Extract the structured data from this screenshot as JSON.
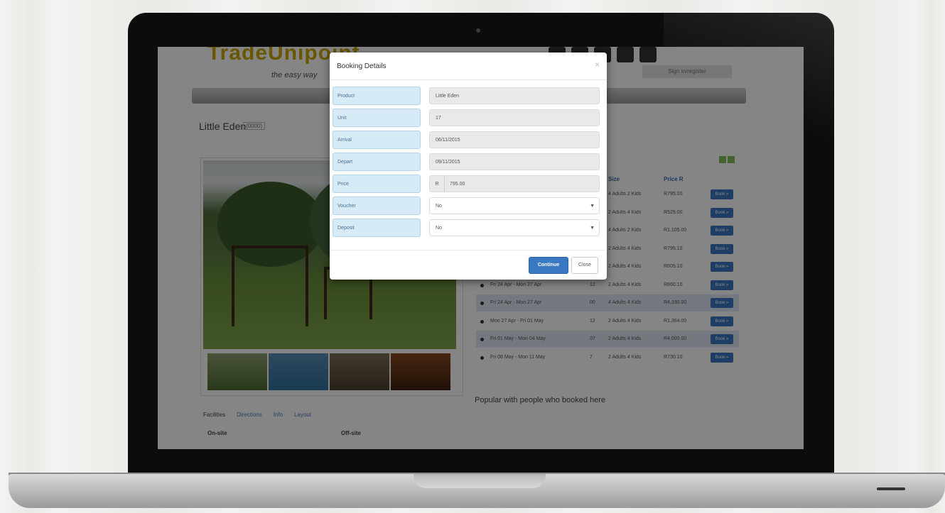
{
  "site": {
    "logo_text": "TradeUnipoint",
    "tagline": "the easy way",
    "sign_in_label": "Sign in/register"
  },
  "page": {
    "title": "Little Eden",
    "title_badge": "(0000)"
  },
  "tabs": [
    {
      "label": "Facilities"
    },
    {
      "label": "Directions"
    },
    {
      "label": "Info"
    },
    {
      "label": "Layout"
    }
  ],
  "subheads": {
    "on_site": "On-site",
    "off_site": "Off-site"
  },
  "availability_table": {
    "headers": {
      "sleeps": "Size",
      "price": "Price R"
    },
    "book_label": "Book »",
    "rows": [
      {
        "dates": "",
        "unit": "",
        "sleeps": "4 Adults 2 Kids",
        "price": "R795.00"
      },
      {
        "dates": "",
        "unit": "",
        "sleeps": "2 Adults 4 Kids",
        "price": "R525.00"
      },
      {
        "dates": "",
        "unit": "",
        "sleeps": "4 Adults 2 Kids",
        "price": "R1,105.00"
      },
      {
        "dates": "",
        "unit": "",
        "sleeps": "2 Adults 4 Kids",
        "price": "R795.10"
      },
      {
        "dates": "",
        "unit": "",
        "sleeps": "2 Adults 4 Kids",
        "price": "R605.10"
      },
      {
        "dates": "Fri 24 Apr - Mon 27 Apr",
        "unit": "12",
        "sleeps": "2 Adults 4 Kids",
        "price": "R660.10"
      },
      {
        "dates": "Fri 24 Apr - Mon 27 Apr",
        "unit": "00",
        "sleeps": "4 Adults 4 Kids",
        "price": "R4,330.00"
      },
      {
        "dates": "Mon 27 Apr - Fri 01 May",
        "unit": "12",
        "sleeps": "2 Adults 4 Kids",
        "price": "R1,364.00"
      },
      {
        "dates": "Fri 01 May - Mon 04 May",
        "unit": "07",
        "sleeps": "2 Adults 4 Kids",
        "price": "R4,000.00"
      },
      {
        "dates": "Fri 08 May - Mon 11 May",
        "unit": "7",
        "sleeps": "2 Adults 4 Kids",
        "price": "R730.10"
      }
    ]
  },
  "popular_text": "Popular with people who booked here",
  "modal": {
    "title": "Booking Details",
    "close_glyph": "×",
    "fields": {
      "product": {
        "label": "Product",
        "value": "Little Eden"
      },
      "unit": {
        "label": "Unit",
        "value": "17"
      },
      "arrival": {
        "label": "Arrival",
        "value": "06/11/2015"
      },
      "depart": {
        "label": "Depart",
        "value": "09/11/2015"
      },
      "price": {
        "label": "Price",
        "currency": "R",
        "value": "795.00"
      },
      "voucher": {
        "label": "Voucher",
        "value": "No"
      },
      "deposit": {
        "label": "Deposit",
        "value": "No"
      }
    },
    "continue_label": "Continue",
    "close_label": "Close"
  },
  "colors": {
    "primary_button": "#3a78c2",
    "label_bg": "#d7ebf7",
    "logo": "#c9a800"
  }
}
